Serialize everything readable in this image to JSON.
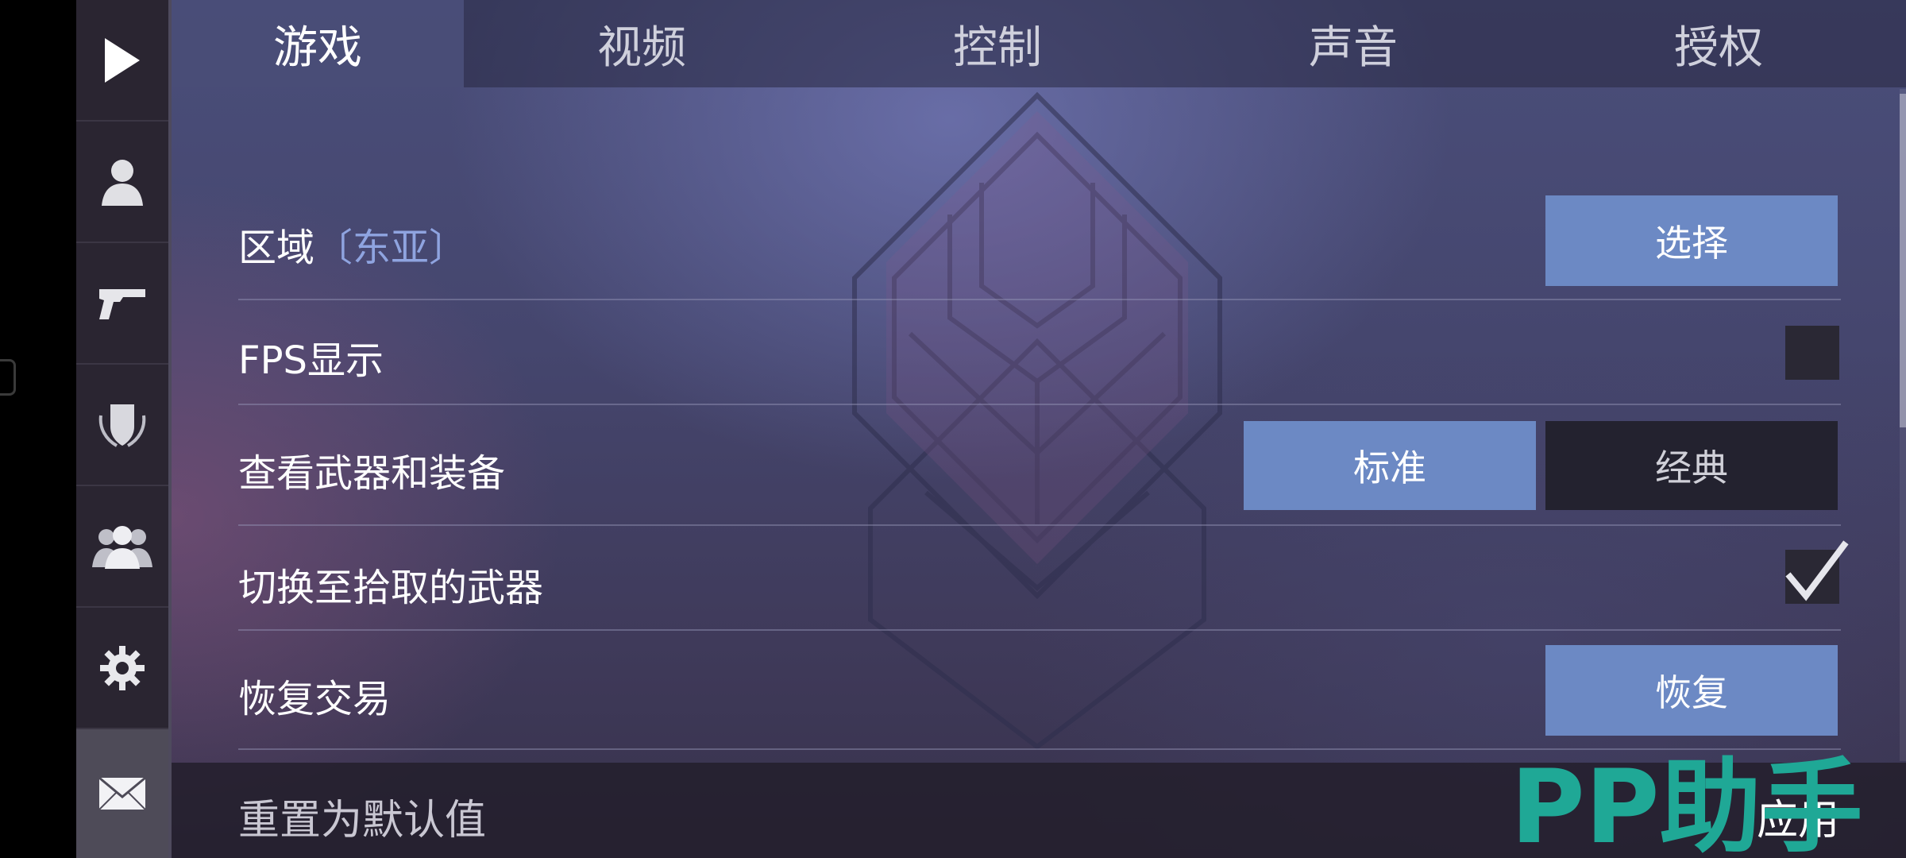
{
  "tabs": [
    {
      "label": "游戏"
    },
    {
      "label": "视频"
    },
    {
      "label": "控制"
    },
    {
      "label": "声音"
    },
    {
      "label": "授权"
    }
  ],
  "sidebar": {
    "items": [
      {
        "icon": "play-icon"
      },
      {
        "icon": "profile-icon"
      },
      {
        "icon": "pistol-icon"
      },
      {
        "icon": "shield-emblem-icon"
      },
      {
        "icon": "friends-icon"
      },
      {
        "icon": "gear-icon"
      },
      {
        "icon": "mail-icon"
      }
    ]
  },
  "settings": {
    "region": {
      "label": "区域",
      "value": "〔东亚〕",
      "button": "选择"
    },
    "fps": {
      "label": "FPS显示",
      "checked": false
    },
    "weapons_view": {
      "label": "查看武器和装备",
      "options": [
        "标准",
        "经典"
      ],
      "selected": "标准"
    },
    "switch_pickup": {
      "label": "切换至拾取的武器",
      "checked": true
    },
    "restore_trade": {
      "label": "恢复交易",
      "button": "恢复"
    }
  },
  "footer": {
    "reset": "重置为默认值",
    "apply": "应用"
  },
  "watermark": "PP助手",
  "colors": {
    "accent_button": "#6c89c4",
    "region_value": "#8fa4e0",
    "watermark": "#1fa896"
  }
}
